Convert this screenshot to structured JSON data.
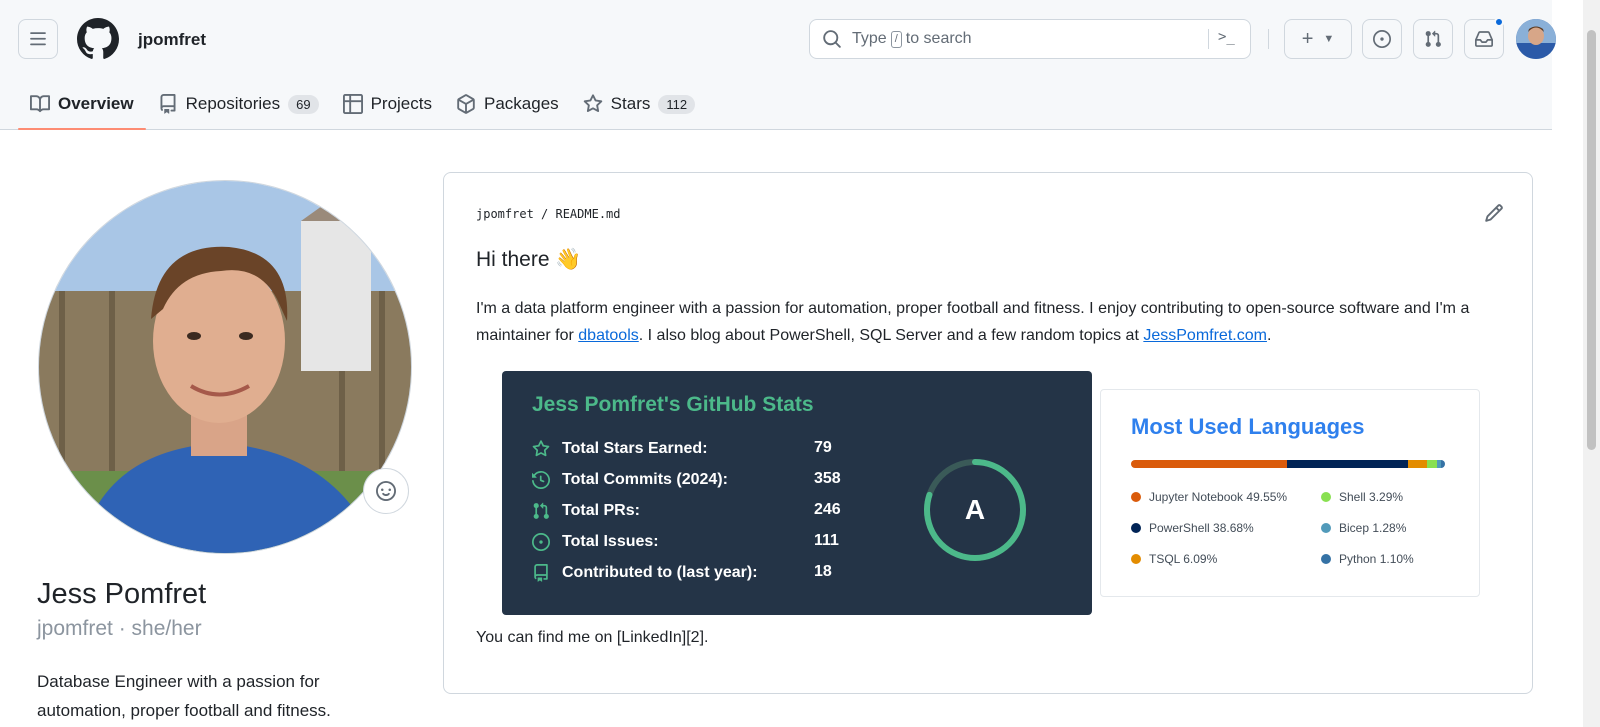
{
  "header": {
    "username": "jpomfret",
    "search_placeholder_prefix": "Type",
    "search_kbd": "/",
    "search_placeholder_suffix": "to search",
    "command_glyph": ">_"
  },
  "tabs": [
    {
      "label": "Overview",
      "icon": "book-icon",
      "active": true
    },
    {
      "label": "Repositories",
      "icon": "repo-icon",
      "count": "69"
    },
    {
      "label": "Projects",
      "icon": "table-icon"
    },
    {
      "label": "Packages",
      "icon": "package-icon"
    },
    {
      "label": "Stars",
      "icon": "star-icon",
      "count": "112"
    }
  ],
  "profile": {
    "full_name": "Jess Pomfret",
    "handle": "jpomfret · she/her",
    "bio": "Database Engineer with a passion for automation, proper football and fitness."
  },
  "readme": {
    "breadcrumb": "jpomfret / README.md",
    "greeting": "Hi there 👋",
    "intro_1": "I'm a data platform engineer with a passion for automation, proper football and fitness. I enjoy contributing to open-source software and I'm a maintainer for ",
    "intro_link_1": "dbatools",
    "intro_2": ". I also blog about PowerShell, SQL Server and a few random topics at ",
    "intro_link_2": "JessPomfret.com",
    "intro_3": ".",
    "find_me": "You can find me on [LinkedIn][2]."
  },
  "stats_card": {
    "title": "Jess Pomfret's GitHub Stats",
    "rows": [
      {
        "label": "Total Stars Earned:",
        "value": "79",
        "icon": "star-icon"
      },
      {
        "label": "Total Commits (2024):",
        "value": "358",
        "icon": "history-icon"
      },
      {
        "label": "Total PRs:",
        "value": "246",
        "icon": "pull-request-icon"
      },
      {
        "label": "Total Issues:",
        "value": "111",
        "icon": "issue-icon"
      },
      {
        "label": "Contributed to (last year):",
        "value": "18",
        "icon": "repo-icon"
      }
    ],
    "grade": "A",
    "grade_progress": 0.8,
    "accent_color": "#4cb98a",
    "bg_color": "#243447"
  },
  "languages_card": {
    "title": "Most Used Languages",
    "languages": [
      {
        "name": "Jupyter Notebook",
        "percent": 49.55,
        "label": "Jupyter Notebook 49.55%",
        "color": "#DA5B0B"
      },
      {
        "name": "PowerShell",
        "percent": 38.68,
        "label": "PowerShell 38.68%",
        "color": "#012456"
      },
      {
        "name": "TSQL",
        "percent": 6.09,
        "label": "TSQL 6.09%",
        "color": "#e38c00"
      },
      {
        "name": "Shell",
        "percent": 3.29,
        "label": "Shell 3.29%",
        "color": "#89e051"
      },
      {
        "name": "Bicep",
        "percent": 1.28,
        "label": "Bicep 1.28%",
        "color": "#519aba"
      },
      {
        "name": "Python",
        "percent": 1.1,
        "label": "Python 1.10%",
        "color": "#3572A5"
      }
    ]
  }
}
